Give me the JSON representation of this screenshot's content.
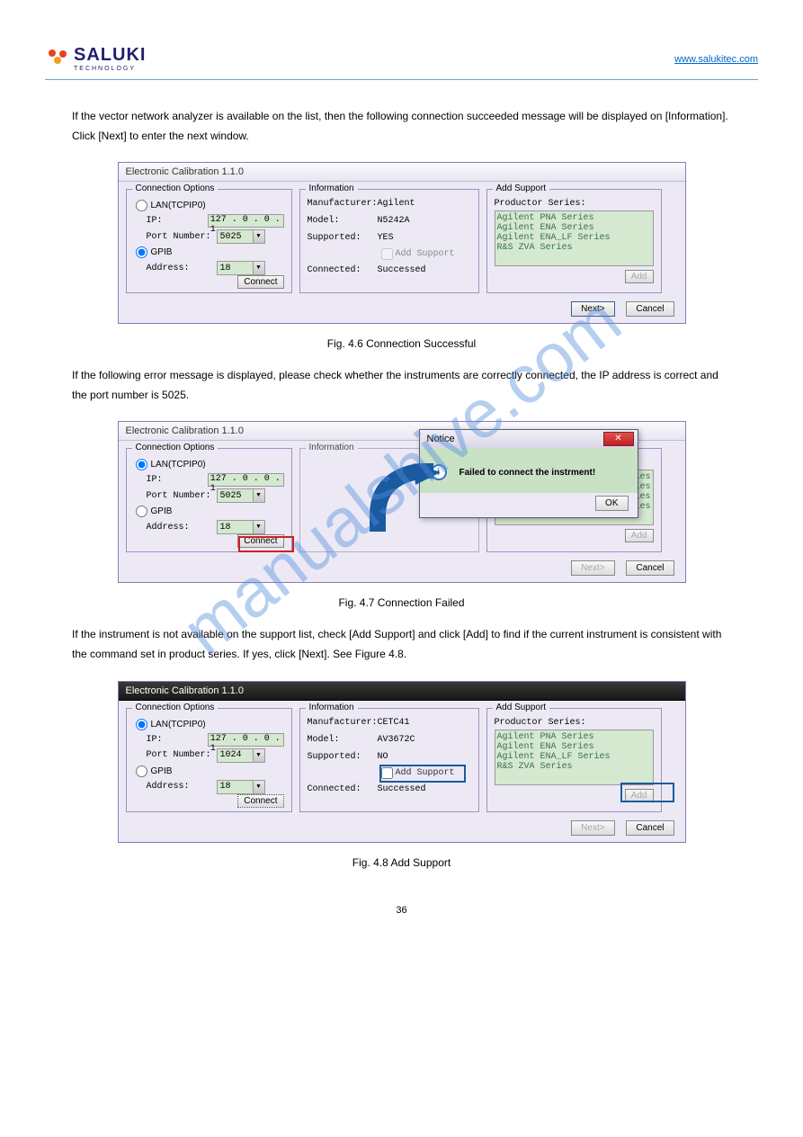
{
  "header": {
    "brand": "SALUKI",
    "brand_sub": "TECHNOLOGY",
    "url": "www.salukitec.com"
  },
  "intro1": "If the vector network analyzer is available on the list, then the following connection succeeded message will be displayed on [Information]. Click [Next] to enter the next window.",
  "dialog_title": "Electronic Calibration 1.1.0",
  "conn": {
    "legend": "Connection Options",
    "lan": "LAN(TCPIP0)",
    "ip_label": "IP:",
    "ip": "127 . 0  . 0  . 1",
    "port_label": "Port Number:",
    "port_a": "5025",
    "port_b": "5025",
    "port_c": "1024",
    "gpib": "GPIB",
    "addr_label": "Address:",
    "addr": "18",
    "connect": "Connect"
  },
  "info": {
    "legend": "Information",
    "mfr_label": "Manufacturer:",
    "mfr_a": "Agilent",
    "mfr_c": "CETC41",
    "model_label": "Model:",
    "model_a": "N5242A",
    "model_c": "AV3672C",
    "sup_label": "Supported:",
    "sup_yes": "YES",
    "sup_no": "NO",
    "add_sup_chk": "Add Support",
    "conn_label": "Connected:",
    "conn_val": "Successed"
  },
  "support": {
    "legend": "Add Support",
    "series_label": "Productor Series:",
    "items": [
      "Agilent PNA Series",
      "Agilent ENA Series",
      "Agilent ENA_LF Series",
      "R&S ZVA Series"
    ],
    "add": "Add"
  },
  "footer": {
    "next": "Next>",
    "cancel": "Cancel"
  },
  "cap1": "Fig. 4.6 Connection Successful",
  "intro2": "If the following error message is displayed, please check whether the instruments are correctly connected, the IP address is correct and the port number is 5025.",
  "notice": {
    "title": "Notice",
    "msg": "Failed to connect the instrment!",
    "ok": "OK"
  },
  "cap2": "Fig. 4.7 Connection Failed",
  "intro3": "If the instrument is not available on the support list, check [Add Support] and click [Add] to find if the current instrument is consistent with the command set in product series. If yes, click [Next]. See Figure 4.8.",
  "cap3": "Fig. 4.8 Add Support",
  "watermark": "manualshive.com",
  "pagenum": "36"
}
